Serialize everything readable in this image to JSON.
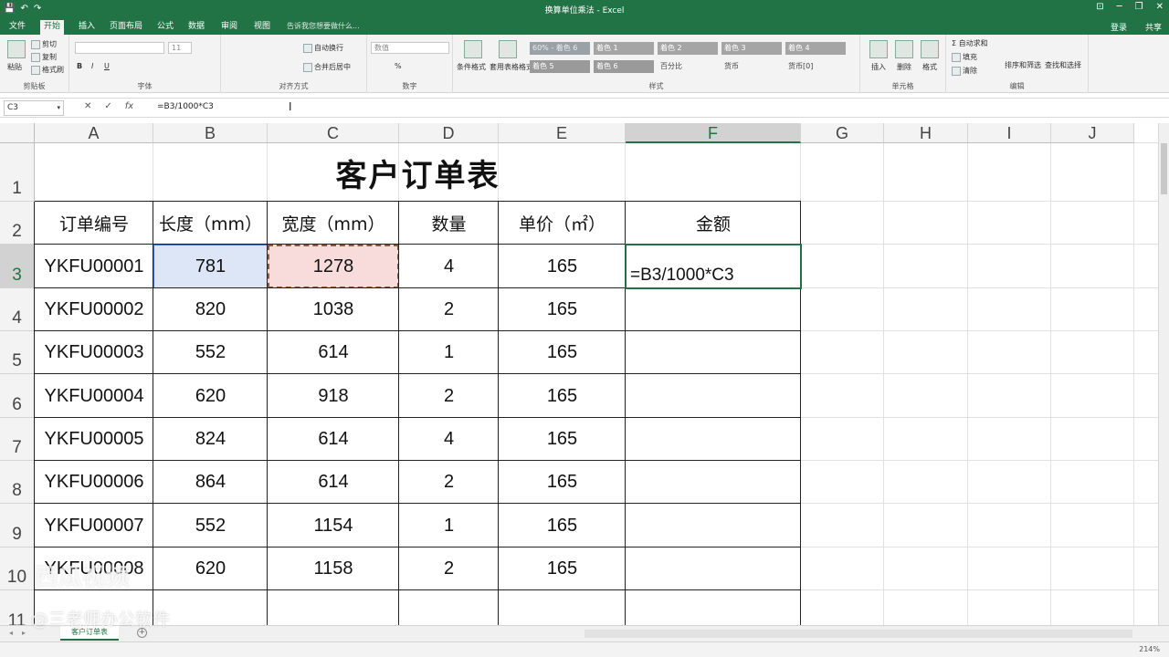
{
  "window": {
    "title": "换算单位乘法 - Excel",
    "qat": [
      "💾",
      "↶",
      "↷"
    ],
    "controls": [
      "⊡",
      "─",
      "❐",
      "✕"
    ]
  },
  "ribbon_tabs": [
    "文件",
    "开始",
    "插入",
    "页面布局",
    "公式",
    "数据",
    "审阅",
    "视图"
  ],
  "active_tab": "开始",
  "tell_me": "告诉我您想要做什么...",
  "account": {
    "login": "登录",
    "share": "共享"
  },
  "ribbon": {
    "clipboard": {
      "paste": "粘贴",
      "cut": "剪切",
      "copy": "复制",
      "painter": "格式刷",
      "label": "剪贴板"
    },
    "font": {
      "size": "11",
      "label": "字体"
    },
    "alignment": {
      "wrap": "自动换行",
      "merge": "合并后居中",
      "label": "对齐方式"
    },
    "number": {
      "format": "数值",
      "label": "数字"
    },
    "styles": {
      "conditional": "条件格式",
      "table": "套用表格格式",
      "cells": [
        "60% - 着色 6",
        "着色 1",
        "着色 2",
        "着色 3",
        "着色 4",
        "着色 5",
        "着色 6",
        "百分比",
        "货币",
        "货币[0]"
      ],
      "label": "样式"
    },
    "cells_group": {
      "insert": "插入",
      "delete": "删除",
      "format": "格式",
      "label": "单元格"
    },
    "editing": {
      "autosum": "自动求和",
      "fill": "填充",
      "clear": "清除",
      "sort": "排序和筛选",
      "find": "查找和选择",
      "label": "编辑"
    }
  },
  "formula_bar": {
    "name_box": "C3",
    "buttons": [
      "✕",
      "✓",
      "fx"
    ],
    "formula": "=B3/1000*C3"
  },
  "columns": [
    "A",
    "B",
    "C",
    "D",
    "E",
    "F",
    "G",
    "H",
    "I",
    "J"
  ],
  "rows": [
    "1",
    "2",
    "3",
    "4",
    "5",
    "6",
    "7",
    "8",
    "9",
    "10",
    "11"
  ],
  "sheet": {
    "title": "客户订单表",
    "headers": [
      "订单编号",
      "长度（mm）",
      "宽度（mm）",
      "数量",
      "单价（㎡）",
      "金额"
    ],
    "data": [
      [
        "YKFU00001",
        "781",
        "1278",
        "4",
        "165",
        "=B3/1000*C3"
      ],
      [
        "YKFU00002",
        "820",
        "1038",
        "2",
        "165",
        ""
      ],
      [
        "YKFU00003",
        "552",
        "614",
        "1",
        "165",
        ""
      ],
      [
        "YKFU00004",
        "620",
        "918",
        "2",
        "165",
        ""
      ],
      [
        "YKFU00005",
        "824",
        "614",
        "4",
        "165",
        ""
      ],
      [
        "YKFU00006",
        "864",
        "614",
        "2",
        "165",
        ""
      ],
      [
        "YKFU00007",
        "552",
        "1154",
        "1",
        "165",
        ""
      ],
      [
        "YKFU00008",
        "620",
        "1158",
        "2",
        "165",
        ""
      ]
    ]
  },
  "sheet_tabs": {
    "active": "客户订单表",
    "add": "+"
  },
  "status": {
    "zoom": "214%"
  },
  "watermark": {
    "line1": "西瓜视频",
    "line2": "@三老师办公软件"
  },
  "colors": {
    "excel_green": "#217346",
    "sel_blue": "#dce6f7",
    "copy_pink": "#f8dcdc"
  }
}
